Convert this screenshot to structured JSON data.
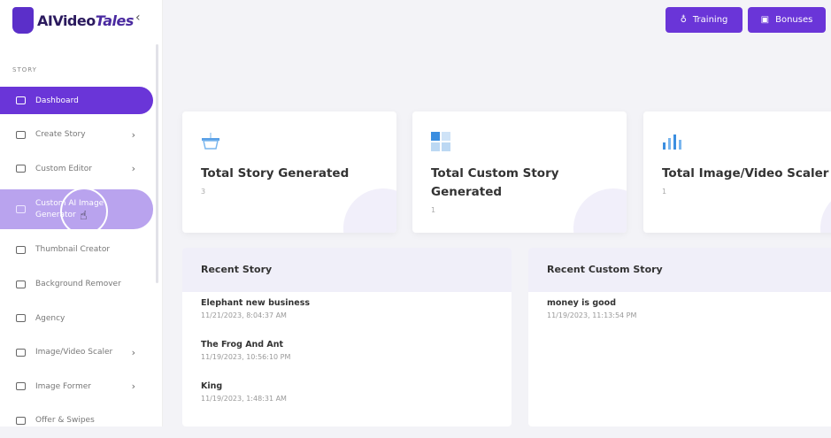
{
  "brand": {
    "name_prefix": "AI",
    "name_mid": "Video",
    "name_suffix": "Tales"
  },
  "sidebar": {
    "section": "STORY",
    "items": [
      {
        "label": "Dashboard",
        "chevron": false,
        "state": "active"
      },
      {
        "label": "Create Story",
        "chevron": true
      },
      {
        "label": "Custom Editor",
        "chevron": true
      },
      {
        "label": "Custom AI Image Generator",
        "chevron": false,
        "state": "hover"
      },
      {
        "label": "Thumbnail Creator",
        "chevron": false
      },
      {
        "label": "Background Remover",
        "chevron": false
      },
      {
        "label": "Agency",
        "chevron": false
      },
      {
        "label": "Image/Video Scaler",
        "chevron": true
      },
      {
        "label": "Image Former",
        "chevron": true
      },
      {
        "label": "Offer & Swipes",
        "chevron": false
      }
    ]
  },
  "header": {
    "training": "Training",
    "bonuses": "Bonuses"
  },
  "stats": [
    {
      "title": "Total Story Generated",
      "value": "3",
      "icon": "basket-icon"
    },
    {
      "title": "Total Custom Story Generated",
      "value": "1",
      "icon": "grid-icon"
    },
    {
      "title": "Total Image/Video Scaler",
      "value": "1",
      "icon": "bar-chart-icon"
    }
  ],
  "recent_story": {
    "title": "Recent Story",
    "items": [
      {
        "name": "Elephant new business",
        "date": "11/21/2023, 8:04:37 AM"
      },
      {
        "name": "The Frog And Ant",
        "date": "11/19/2023, 10:56:10 PM"
      },
      {
        "name": "King",
        "date": "11/19/2023, 1:48:31 AM"
      }
    ]
  },
  "recent_custom": {
    "title": "Recent Custom Story",
    "items": [
      {
        "name": "money is good",
        "date": "11/19/2023, 11:13:54 PM"
      }
    ]
  },
  "colors": {
    "accent": "#6a35d8",
    "hover": "#b9a3ee"
  }
}
